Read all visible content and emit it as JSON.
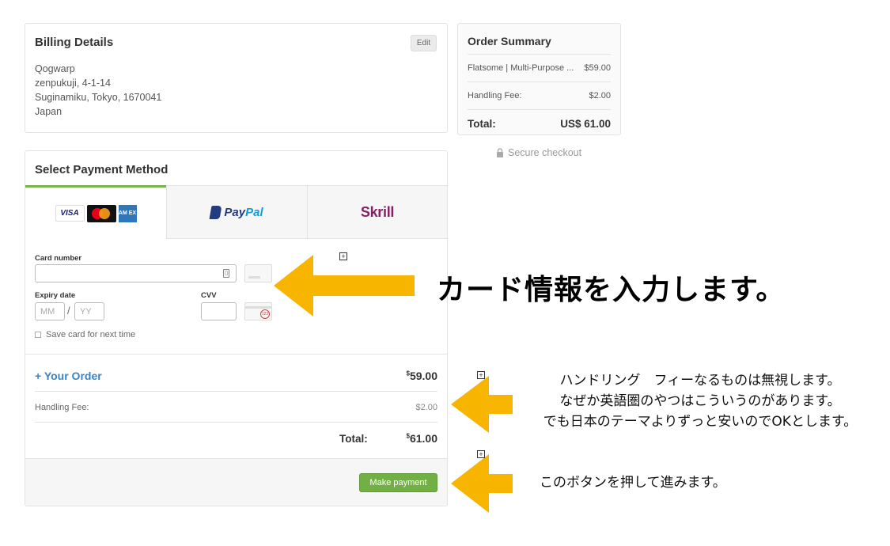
{
  "billing": {
    "title": "Billing Details",
    "edit_label": "Edit",
    "address_lines": [
      "Qogwarp",
      "zenpukuji, 4-1-14",
      "Suginamiku, Tokyo, 1670041",
      "Japan"
    ]
  },
  "summary": {
    "title": "Order Summary",
    "rows": [
      {
        "label": "Flatsome | Multi-Purpose ...",
        "value": "$59.00"
      },
      {
        "label": "Handling Fee:",
        "value": "$2.00"
      }
    ],
    "total_label": "Total:",
    "total_value": "US$ 61.00",
    "secure": "Secure checkout"
  },
  "payment": {
    "title": "Select Payment Method",
    "tabs": {
      "cards": {
        "visa": "VISA",
        "amex": "AM EX"
      },
      "paypal": {
        "pay": "Pay",
        "pal": "Pal"
      },
      "skrill": "Skrill"
    },
    "card_number_label": "Card number",
    "expiry_label": "Expiry date",
    "mm_placeholder": "MM",
    "yy_placeholder": "YY",
    "slash": "/",
    "cvv_label": "CVV",
    "cvv_icon_text": "123",
    "save_card": "Save card for next time",
    "your_order": "+ Your Order",
    "order_amount_sup": "$",
    "order_amount": "59.00",
    "handling_label": "Handling Fee:",
    "handling_value": "$2.00",
    "total_label": "Total:",
    "total_sup": "$",
    "total_amount": "61.00",
    "make_payment": "Make payment"
  },
  "annotations": {
    "big": "カード情報を入力します。",
    "note1": [
      "ハンドリング　フィーなるものは無視します。",
      "なぜか英語圏のやつはこういうのがあります。",
      "でも日本のテーマよりずっと安いのでOKとします。"
    ],
    "note2": "このボタンを押して進みます。",
    "plus_symbol": "+",
    "arrow_color": "#f7b500"
  }
}
